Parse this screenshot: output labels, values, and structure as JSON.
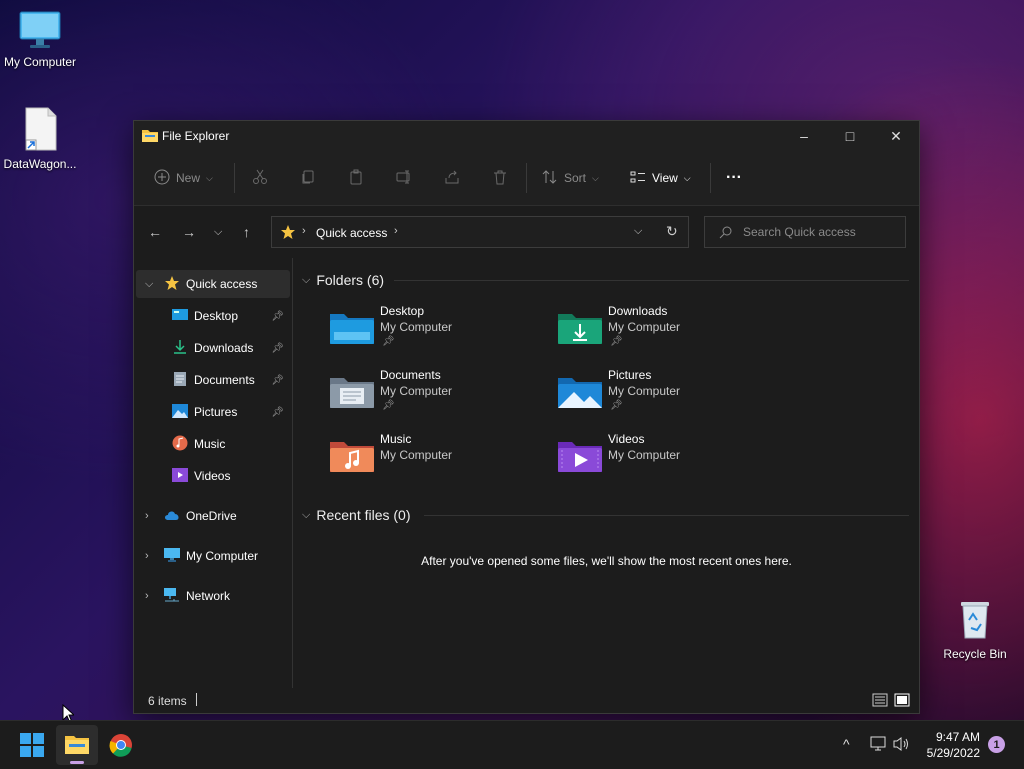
{
  "desktop": {
    "icons": [
      {
        "label": "My Computer"
      },
      {
        "label": "DataWagon..."
      },
      {
        "label": "Recycle Bin"
      }
    ]
  },
  "window": {
    "title": "File Explorer",
    "controls": {
      "minimize": "–",
      "maximize": "□",
      "close": "✕"
    }
  },
  "toolbar": {
    "new_label": "New",
    "sort_label": "Sort",
    "view_label": "View",
    "more_label": "···"
  },
  "address": {
    "path": "Quick access"
  },
  "search": {
    "placeholder": "Search Quick access"
  },
  "sidebar": {
    "items": [
      {
        "label": "Quick access"
      },
      {
        "label": "Desktop"
      },
      {
        "label": "Downloads"
      },
      {
        "label": "Documents"
      },
      {
        "label": "Pictures"
      },
      {
        "label": "Music"
      },
      {
        "label": "Videos"
      },
      {
        "label": "OneDrive"
      },
      {
        "label": "My Computer"
      },
      {
        "label": "Network"
      }
    ]
  },
  "content": {
    "folders_heading": "Folders (6)",
    "folders": [
      {
        "name": "Desktop",
        "location": "My Computer",
        "color": "#1e9be0"
      },
      {
        "name": "Downloads",
        "location": "My Computer",
        "color": "#1aa57a"
      },
      {
        "name": "Documents",
        "location": "My Computer",
        "color": "#8c9aa8"
      },
      {
        "name": "Pictures",
        "location": "My Computer",
        "color": "#1e88d8"
      },
      {
        "name": "Music",
        "location": "My Computer",
        "color": "#e46a4a"
      },
      {
        "name": "Videos",
        "location": "My Computer",
        "color": "#8a4ad8"
      }
    ],
    "recent_heading": "Recent files (0)",
    "recent_empty": "After you've opened some files, we'll show the most recent ones here."
  },
  "status": {
    "items_count": "6 items"
  },
  "taskbar": {
    "time": "9:47 AM",
    "date": "5/29/2022",
    "notification_count": "1"
  }
}
